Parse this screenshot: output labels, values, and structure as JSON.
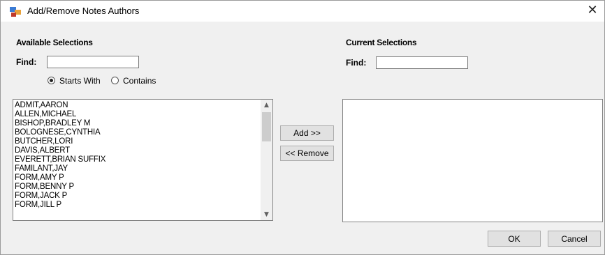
{
  "window": {
    "title": "Add/Remove Notes Authors",
    "close_glyph": "✕"
  },
  "available": {
    "heading": "Available Selections",
    "find_label": "Find:",
    "find_value": "",
    "radio_starts_with": "Starts With",
    "radio_contains": "Contains",
    "selected_mode": "Starts With",
    "items": [
      "ADMIT,AARON",
      "ALLEN,MICHAEL",
      "BISHOP,BRADLEY M",
      "BOLOGNESE,CYNTHIA",
      "BUTCHER,LORI",
      "DAVIS,ALBERT",
      "EVERETT,BRIAN SUFFIX",
      "FAMILANT,JAY",
      "FORM,AMY P",
      "FORM,BENNY P",
      "FORM,JACK P",
      "FORM,JILL P"
    ]
  },
  "current": {
    "heading": "Current Selections",
    "find_label": "Find:",
    "find_value": "",
    "items": []
  },
  "actions": {
    "add_label": "Add >>",
    "remove_label": "<< Remove",
    "ok_label": "OK",
    "cancel_label": "Cancel"
  },
  "icons": {
    "app": "dialog-app-icon",
    "close": "close-icon",
    "scroll_up": "scroll-up-arrow-icon",
    "scroll_down": "scroll-down-arrow-icon"
  }
}
